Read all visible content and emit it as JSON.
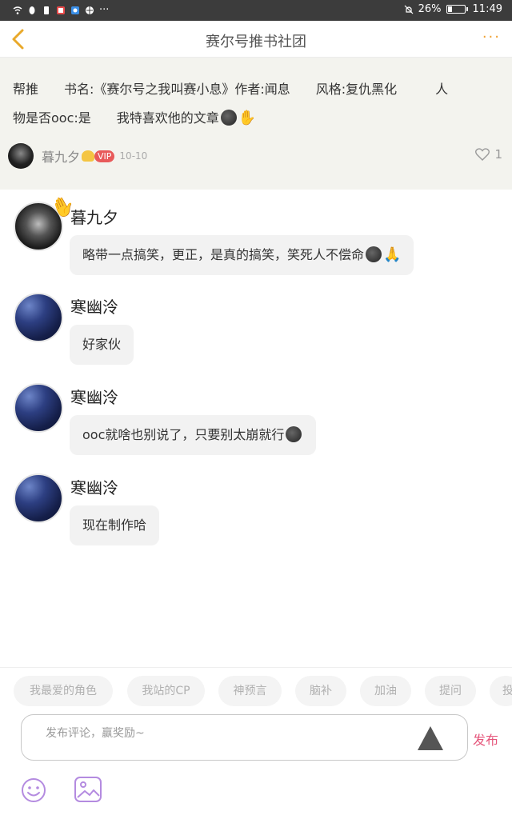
{
  "status_bar": {
    "battery_percent": "26%",
    "time": "11:49",
    "more_dots": "···"
  },
  "header": {
    "title": "赛尔号推书社团"
  },
  "post": {
    "line1": "帮推　　书名:《赛尔号之我叫赛小息》作者:闻息　　风格:复仇黑化　　　人",
    "line2": "物是否ooc:是　　我特喜欢他的文章",
    "author": "暮九夕",
    "vip": "VIP",
    "date": "10-10",
    "likes": "1"
  },
  "comments": [
    {
      "name": "暮九夕",
      "text": "略带一点搞笑，更正，是真的搞笑，笑死人不偿命"
    },
    {
      "name": "寒幽泠",
      "text": "好家伙"
    },
    {
      "name": "寒幽泠",
      "text": "ooc就啥也别说了，只要别太崩就行"
    },
    {
      "name": "寒幽泠",
      "text": "现在制作哈"
    }
  ],
  "tags": [
    "我最爱的角色",
    "我站的CP",
    "神预言",
    "脑补",
    "加油",
    "提问",
    "投"
  ],
  "input": {
    "placeholder": "发布评论，赢奖励~",
    "publish_label": "发布"
  },
  "colors": {
    "accent_orange": "#f0a030",
    "publish_pink": "#e5567b",
    "vip_red": "#e85a5a"
  }
}
